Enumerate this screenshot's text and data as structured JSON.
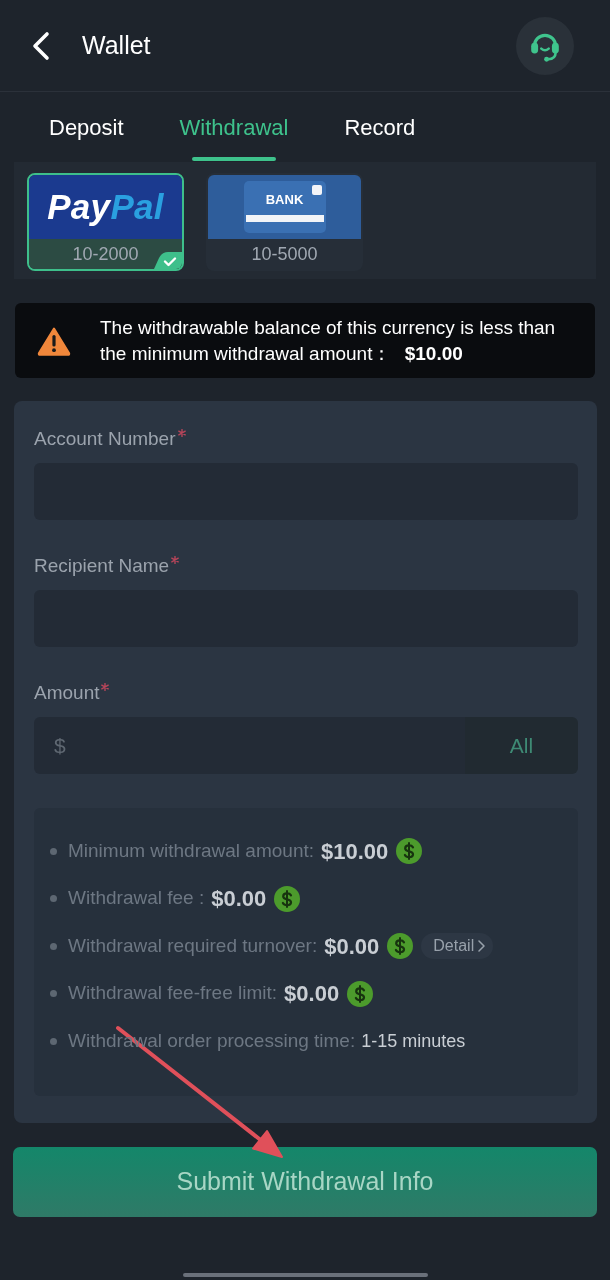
{
  "header": {
    "title": "Wallet"
  },
  "tabs": [
    {
      "label": "Deposit",
      "selected": false
    },
    {
      "label": "Withdrawal",
      "selected": true
    },
    {
      "label": "Record",
      "selected": false
    }
  ],
  "methods": [
    {
      "kind": "paypal",
      "logo": [
        "Pay",
        "Pal"
      ],
      "range": "10-2000",
      "selected": true
    },
    {
      "kind": "bank",
      "logo": [
        "BANK"
      ],
      "range": "10-5000",
      "selected": false
    }
  ],
  "warning": {
    "message": "The withdrawable balance of this currency is less than the minimum withdrawal amount： **$10.00**"
  },
  "form": {
    "fields": [
      {
        "kind": "text",
        "label": "Account Number",
        "required": true
      },
      {
        "kind": "text",
        "label": "Recipient Name",
        "required": true
      },
      {
        "kind": "amount",
        "label": "Amount",
        "required": true,
        "placeholder": "$",
        "action": "All"
      }
    ],
    "info": [
      {
        "kind": "money",
        "label": "Minimum withdrawal amount:",
        "value": "$10.00"
      },
      {
        "kind": "money",
        "label": "Withdrawal fee :",
        "value": "$0.00"
      },
      {
        "kind": "money",
        "label": "Withdrawal required turnover:",
        "value": "$0.00",
        "link": "Detail"
      },
      {
        "kind": "money",
        "label": "Withdrawal fee-free limit:",
        "value": "$0.00"
      },
      {
        "kind": "time",
        "label": "Withdrawal order processing time:",
        "value": "1-15 minutes"
      }
    ]
  },
  "submit": {
    "label": "Submit Withdrawal Info",
    "disabled": true
  }
}
